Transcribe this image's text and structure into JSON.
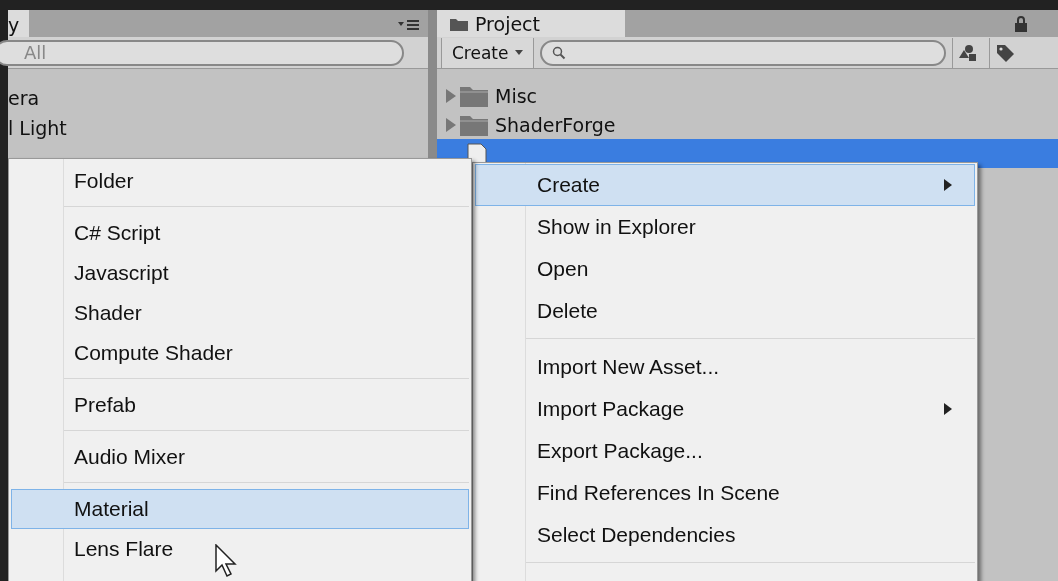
{
  "hierarchy": {
    "tab": "y",
    "search": {
      "value": "All"
    },
    "items": [
      {
        "name": "era"
      },
      {
        "name": "l Light"
      }
    ]
  },
  "project": {
    "tab": "Project",
    "create_button": "Create",
    "assets": [
      {
        "name": "Misc",
        "kind": "folder",
        "selected": false
      },
      {
        "name": "ShaderForge",
        "kind": "folder",
        "selected": false
      },
      {
        "kind": "shader",
        "selected": true
      }
    ]
  },
  "context_menu": {
    "items": [
      {
        "kind": "item",
        "label": "Create",
        "submenu": true,
        "selected": true
      },
      {
        "kind": "item",
        "label": "Show in Explorer",
        "submenu": false,
        "selected": false
      },
      {
        "kind": "item",
        "label": "Open",
        "submenu": false,
        "selected": false
      },
      {
        "kind": "item",
        "label": "Delete",
        "submenu": false,
        "selected": false
      },
      {
        "kind": "separator"
      },
      {
        "kind": "item",
        "label": "Import New Asset...",
        "submenu": false,
        "selected": false
      },
      {
        "kind": "item",
        "label": "Import Package",
        "submenu": true,
        "selected": false
      },
      {
        "kind": "item",
        "label": "Export Package...",
        "submenu": false,
        "selected": false
      },
      {
        "kind": "item",
        "label": "Find References In Scene",
        "submenu": false,
        "selected": false
      },
      {
        "kind": "item",
        "label": "Select Dependencies",
        "submenu": false,
        "selected": false
      },
      {
        "kind": "separator"
      }
    ]
  },
  "create_submenu": {
    "items": [
      {
        "kind": "item",
        "label": "Folder",
        "selected": false
      },
      {
        "kind": "separator"
      },
      {
        "kind": "item",
        "label": "C# Script",
        "selected": false
      },
      {
        "kind": "item",
        "label": "Javascript",
        "selected": false
      },
      {
        "kind": "item",
        "label": "Shader",
        "selected": false
      },
      {
        "kind": "item",
        "label": "Compute Shader",
        "selected": false
      },
      {
        "kind": "separator"
      },
      {
        "kind": "item",
        "label": "Prefab",
        "selected": false
      },
      {
        "kind": "separator"
      },
      {
        "kind": "item",
        "label": "Audio Mixer",
        "selected": false
      },
      {
        "kind": "separator"
      },
      {
        "kind": "item",
        "label": "Material",
        "selected": true
      },
      {
        "kind": "item",
        "label": "Lens Flare",
        "selected": false
      }
    ]
  }
}
